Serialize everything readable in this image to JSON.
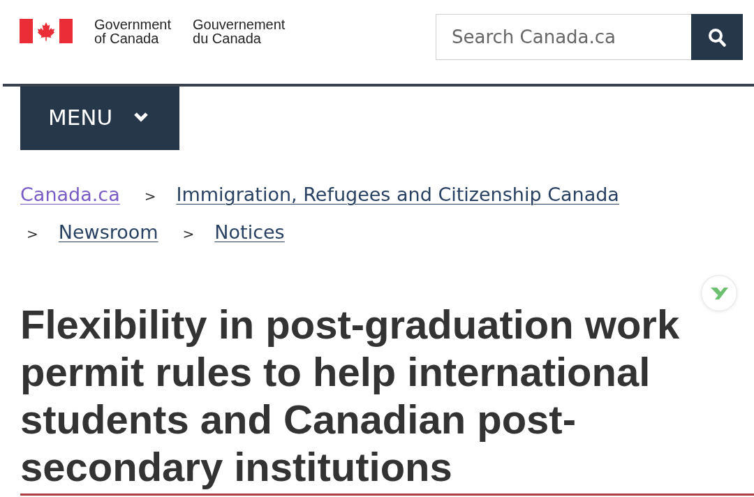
{
  "header": {
    "wordmark": {
      "english": [
        "Government",
        "of Canada"
      ],
      "french": [
        "Gouvernement",
        "du Canada"
      ]
    },
    "search": {
      "placeholder": "Search Canada.ca"
    }
  },
  "menu": {
    "label": "MENU",
    "expanded": false
  },
  "breadcrumb": [
    {
      "label": "Canada.ca",
      "visited": true
    },
    {
      "separator": ">",
      "label": "Immigration, Refugees and Citizenship Canada",
      "visited": false
    },
    {
      "separator": ">",
      "label": "Newsroom",
      "visited": false
    },
    {
      "separator": ">",
      "label": "Notices",
      "visited": false
    }
  ],
  "title": "Flexibility in post-graduation work permit rules to help international students and Canadian post-secondary institutions"
}
